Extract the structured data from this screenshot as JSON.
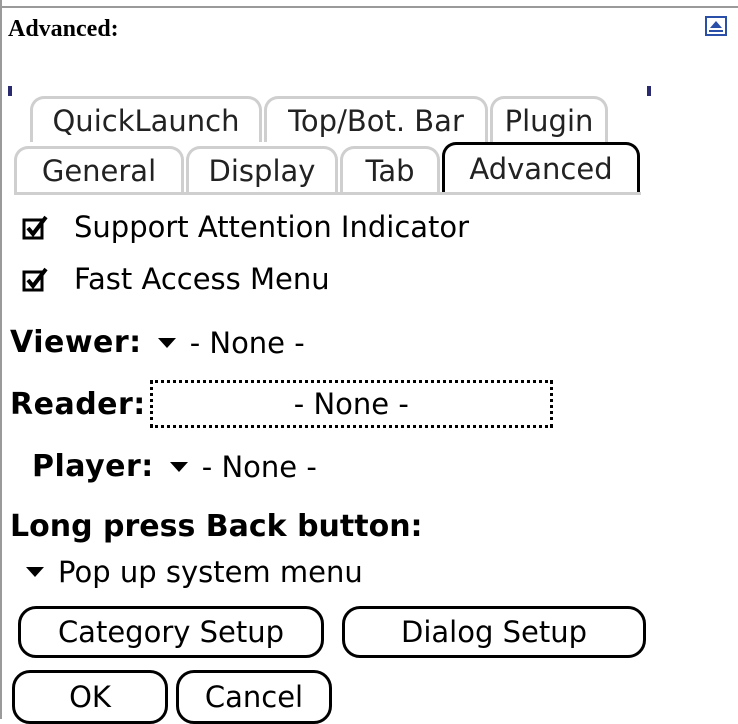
{
  "window": {
    "title": "Advanced:"
  },
  "tabs": {
    "row1": [
      "QuickLaunch",
      "Top/Bot. Bar",
      "Plugin"
    ],
    "row2": [
      "General",
      "Display",
      "Tab",
      "Advanced"
    ],
    "active": "Advanced"
  },
  "options": {
    "support_attention": {
      "label": "Support Attention Indicator",
      "checked": true
    },
    "fast_access": {
      "label": "Fast Access Menu",
      "checked": true
    }
  },
  "viewer": {
    "label": "Viewer:",
    "value": "- None -"
  },
  "reader": {
    "label": "Reader:",
    "value": "- None -"
  },
  "player": {
    "label": "Player:",
    "value": "- None -"
  },
  "long_press": {
    "label": "Long press Back button:",
    "value": "Pop up system menu"
  },
  "buttons": {
    "category_setup": "Category Setup",
    "dialog_setup": "Dialog Setup",
    "ok": "OK",
    "cancel": "Cancel"
  },
  "icons": {
    "scroll": "scroll-up-arrow-icon",
    "check": "checkbox-checked-icon",
    "dropdown": "dropdown-triangle-icon"
  },
  "colors": {
    "accent": "#2a4fa8",
    "inactive_tab_border": "#cfcfcf"
  }
}
